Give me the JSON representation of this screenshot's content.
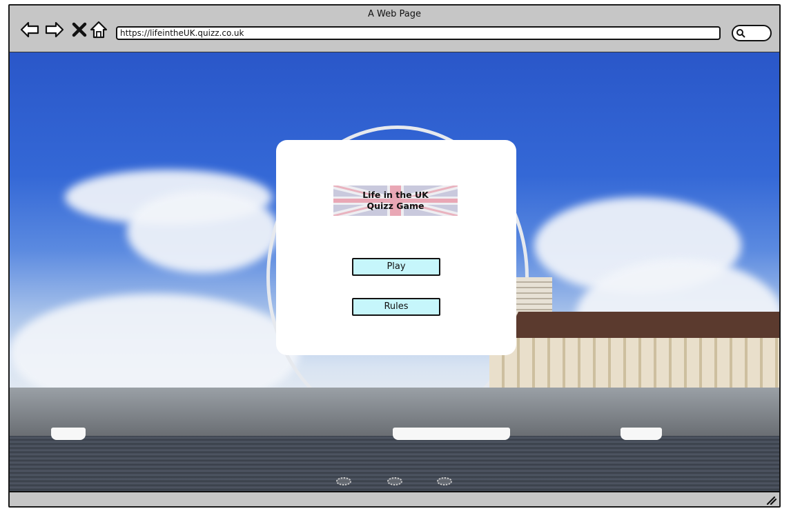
{
  "window": {
    "title": "A Web Page"
  },
  "toolbar": {
    "back_icon": "back-arrow-icon",
    "forward_icon": "forward-arrow-icon",
    "stop_icon": "close-icon",
    "home_icon": "home-icon",
    "url": "https://lifeintheUK.quizz.co.uk",
    "search_icon": "search-icon"
  },
  "dialog": {
    "logo_text": "Life in the UK\nQuizz Game",
    "play_label": "Play",
    "rules_label": "Rules"
  },
  "carousel": {
    "dots": 3
  },
  "colors": {
    "button_fill": "#c6f6fb",
    "chrome": "#c6c6c6"
  }
}
